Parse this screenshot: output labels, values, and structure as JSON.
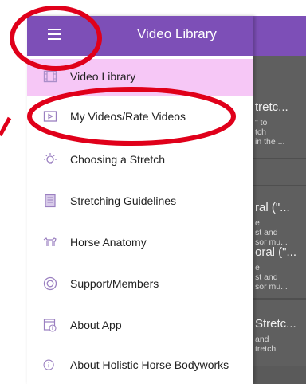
{
  "header": {
    "title": "Video Library",
    "menu_icon": "hamburger-icon"
  },
  "theme": {
    "accent": "#7d4fb7",
    "active_item_bg": "#f6c7f6",
    "annotation": "#e0001a"
  },
  "menu": {
    "items": [
      {
        "label": "Video Library",
        "icon": "film-icon"
      },
      {
        "label": "My Videos/Rate Videos",
        "icon": "play-box-icon"
      },
      {
        "label": "Choosing a Stretch",
        "icon": "lightbulb-icon"
      },
      {
        "label": "Stretching Guidelines",
        "icon": "document-icon"
      },
      {
        "label": "Horse Anatomy",
        "icon": "horse-icon"
      },
      {
        "label": "Support/Members",
        "icon": "lifebuoy-icon"
      },
      {
        "label": "About App",
        "icon": "calendar-info-icon"
      },
      {
        "label": "About Holistic Horse Bodyworks",
        "icon": "info-icon"
      }
    ]
  },
  "background_list": {
    "cards": [
      {
        "title": "tretc...",
        "lines": [
          "\" to",
          "tch",
          "in the ..."
        ]
      },
      {
        "title": "ral (\"...",
        "lines": [
          "e",
          "st and",
          "sor mu..."
        ]
      },
      {
        "title": "oral (\"...",
        "lines": [
          "e",
          "st and",
          "sor mu..."
        ]
      },
      {
        "title": "Stretc...",
        "lines": [
          "and",
          "tretch"
        ]
      }
    ]
  }
}
